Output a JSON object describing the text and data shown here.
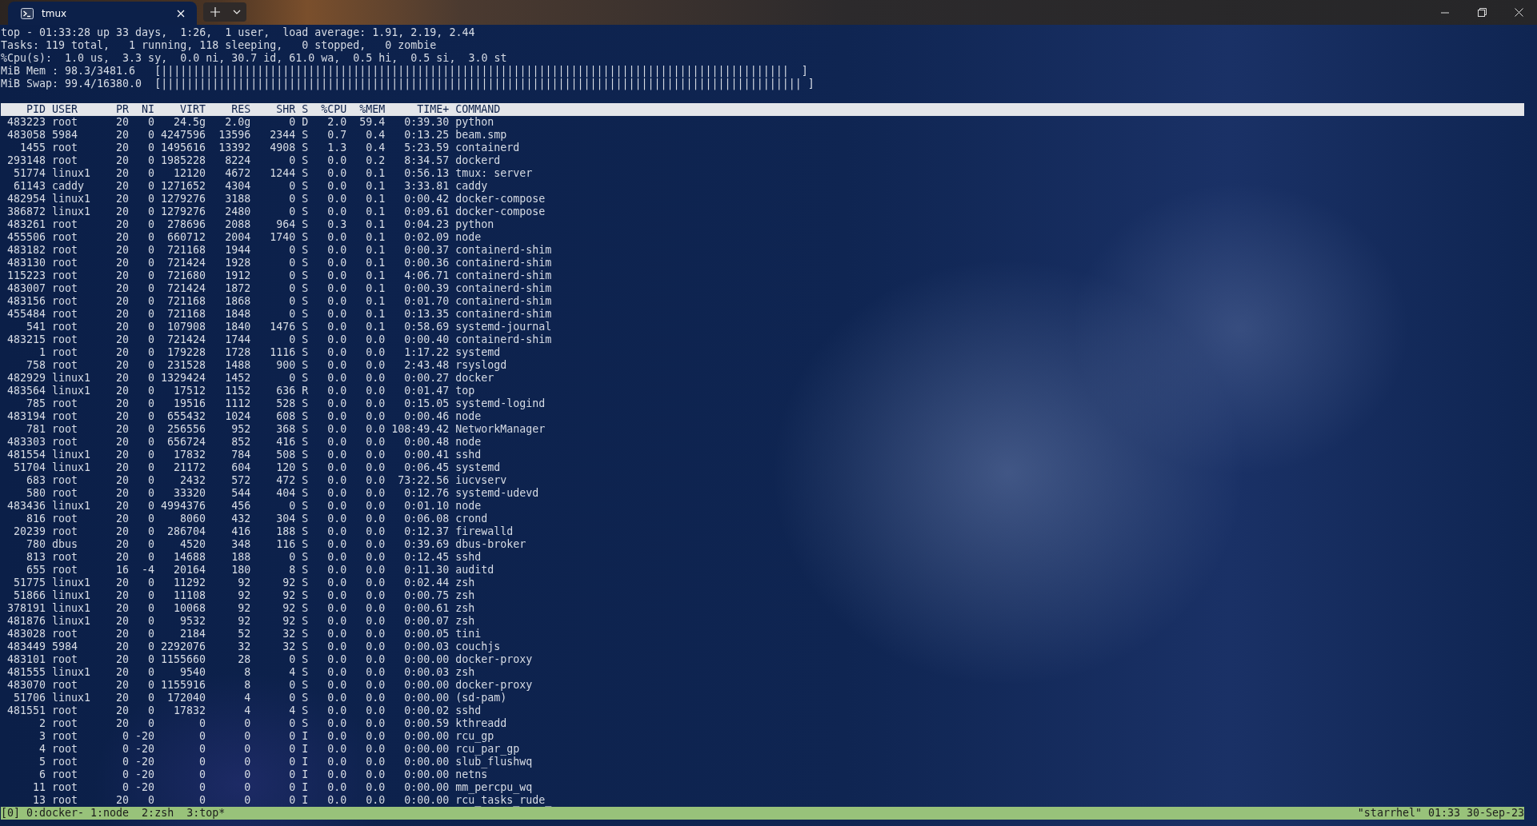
{
  "window": {
    "tabs": [
      {
        "title": "tmux",
        "selected": true
      }
    ]
  },
  "summary": [
    "top - 01:33:28 up 33 days,  1:26,  1 user,  load average: 1.91, 2.19, 2.44",
    "Tasks: 119 total,   1 running, 118 sleeping,   0 stopped,   0 zombie",
    "%Cpu(s):  1.0 us,  3.3 sy,  0.0 ni, 30.7 id, 61.0 wa,  0.5 hi,  0.5 si,  3.0 st"
  ],
  "memory": [
    {
      "label": "MiB Mem : 98.3/3481.6",
      "bar": "[||||||||||||||||||||||||||||||||||||||||||||||||||||||||||||||||||||||||||||||||||||||||||||||||||  ]"
    },
    {
      "label": "MiB Swap: 99.4/16380.0",
      "bar": "[|||||||||||||||||||||||||||||||||||||||||||||||||||||||||||||||||||||||||||||||||||||||||||||||||||| ]"
    }
  ],
  "table": {
    "columns": [
      "PID",
      "USER",
      "PR",
      "NI",
      "VIRT",
      "RES",
      "SHR",
      "S",
      "%CPU",
      "%MEM",
      "TIME+",
      "COMMAND"
    ],
    "rows": [
      [
        "483223",
        "root",
        "20",
        "0",
        "24.5g",
        "2.0g",
        "0",
        "D",
        "2.0",
        "59.4",
        "0:39.30",
        "python"
      ],
      [
        "483058",
        "5984",
        "20",
        "0",
        "4247596",
        "13596",
        "2344",
        "S",
        "0.7",
        "0.4",
        "0:13.25",
        "beam.smp"
      ],
      [
        "1455",
        "root",
        "20",
        "0",
        "1495616",
        "13392",
        "4908",
        "S",
        "1.3",
        "0.4",
        "5:23.59",
        "containerd"
      ],
      [
        "293148",
        "root",
        "20",
        "0",
        "1985228",
        "8224",
        "0",
        "S",
        "0.0",
        "0.2",
        "8:34.57",
        "dockerd"
      ],
      [
        "51774",
        "linux1",
        "20",
        "0",
        "12120",
        "4672",
        "1244",
        "S",
        "0.0",
        "0.1",
        "0:56.13",
        "tmux: server"
      ],
      [
        "61143",
        "caddy",
        "20",
        "0",
        "1271652",
        "4304",
        "0",
        "S",
        "0.0",
        "0.1",
        "3:33.81",
        "caddy"
      ],
      [
        "482954",
        "linux1",
        "20",
        "0",
        "1279276",
        "3188",
        "0",
        "S",
        "0.0",
        "0.1",
        "0:00.42",
        "docker-compose"
      ],
      [
        "386872",
        "linux1",
        "20",
        "0",
        "1279276",
        "2480",
        "0",
        "S",
        "0.0",
        "0.1",
        "0:09.61",
        "docker-compose"
      ],
      [
        "483261",
        "root",
        "20",
        "0",
        "278696",
        "2088",
        "964",
        "S",
        "0.3",
        "0.1",
        "0:04.23",
        "python"
      ],
      [
        "455506",
        "root",
        "20",
        "0",
        "660712",
        "2004",
        "1740",
        "S",
        "0.0",
        "0.1",
        "0:02.09",
        "node"
      ],
      [
        "483182",
        "root",
        "20",
        "0",
        "721168",
        "1944",
        "0",
        "S",
        "0.0",
        "0.1",
        "0:00.37",
        "containerd-shim"
      ],
      [
        "483130",
        "root",
        "20",
        "0",
        "721424",
        "1928",
        "0",
        "S",
        "0.0",
        "0.1",
        "0:00.36",
        "containerd-shim"
      ],
      [
        "115223",
        "root",
        "20",
        "0",
        "721680",
        "1912",
        "0",
        "S",
        "0.0",
        "0.1",
        "4:06.71",
        "containerd-shim"
      ],
      [
        "483007",
        "root",
        "20",
        "0",
        "721424",
        "1872",
        "0",
        "S",
        "0.0",
        "0.1",
        "0:00.39",
        "containerd-shim"
      ],
      [
        "483156",
        "root",
        "20",
        "0",
        "721168",
        "1868",
        "0",
        "S",
        "0.0",
        "0.1",
        "0:01.70",
        "containerd-shim"
      ],
      [
        "455484",
        "root",
        "20",
        "0",
        "721168",
        "1848",
        "0",
        "S",
        "0.0",
        "0.1",
        "0:13.35",
        "containerd-shim"
      ],
      [
        "541",
        "root",
        "20",
        "0",
        "107908",
        "1840",
        "1476",
        "S",
        "0.0",
        "0.1",
        "0:58.69",
        "systemd-journal"
      ],
      [
        "483215",
        "root",
        "20",
        "0",
        "721424",
        "1744",
        "0",
        "S",
        "0.0",
        "0.0",
        "0:00.40",
        "containerd-shim"
      ],
      [
        "1",
        "root",
        "20",
        "0",
        "179228",
        "1728",
        "1116",
        "S",
        "0.0",
        "0.0",
        "1:17.22",
        "systemd"
      ],
      [
        "758",
        "root",
        "20",
        "0",
        "231528",
        "1488",
        "900",
        "S",
        "0.0",
        "0.0",
        "2:43.48",
        "rsyslogd"
      ],
      [
        "482929",
        "linux1",
        "20",
        "0",
        "1329424",
        "1452",
        "0",
        "S",
        "0.0",
        "0.0",
        "0:00.27",
        "docker"
      ],
      [
        "483564",
        "linux1",
        "20",
        "0",
        "17512",
        "1152",
        "636",
        "R",
        "0.0",
        "0.0",
        "0:01.47",
        "top"
      ],
      [
        "785",
        "root",
        "20",
        "0",
        "19516",
        "1112",
        "528",
        "S",
        "0.0",
        "0.0",
        "0:15.05",
        "systemd-logind"
      ],
      [
        "483194",
        "root",
        "20",
        "0",
        "655432",
        "1024",
        "608",
        "S",
        "0.0",
        "0.0",
        "0:00.46",
        "node"
      ],
      [
        "781",
        "root",
        "20",
        "0",
        "256556",
        "952",
        "368",
        "S",
        "0.0",
        "0.0",
        "108:49.42",
        "NetworkManager"
      ],
      [
        "483303",
        "root",
        "20",
        "0",
        "656724",
        "852",
        "416",
        "S",
        "0.0",
        "0.0",
        "0:00.48",
        "node"
      ],
      [
        "481554",
        "linux1",
        "20",
        "0",
        "17832",
        "784",
        "508",
        "S",
        "0.0",
        "0.0",
        "0:00.41",
        "sshd"
      ],
      [
        "51704",
        "linux1",
        "20",
        "0",
        "21172",
        "604",
        "120",
        "S",
        "0.0",
        "0.0",
        "0:06.45",
        "systemd"
      ],
      [
        "683",
        "root",
        "20",
        "0",
        "2432",
        "572",
        "472",
        "S",
        "0.0",
        "0.0",
        "73:22.56",
        "iucvserv"
      ],
      [
        "580",
        "root",
        "20",
        "0",
        "33320",
        "544",
        "404",
        "S",
        "0.0",
        "0.0",
        "0:12.76",
        "systemd-udevd"
      ],
      [
        "483436",
        "linux1",
        "20",
        "0",
        "4994376",
        "456",
        "0",
        "S",
        "0.0",
        "0.0",
        "0:01.10",
        "node"
      ],
      [
        "816",
        "root",
        "20",
        "0",
        "8060",
        "432",
        "304",
        "S",
        "0.0",
        "0.0",
        "0:06.08",
        "crond"
      ],
      [
        "20239",
        "root",
        "20",
        "0",
        "286704",
        "416",
        "188",
        "S",
        "0.0",
        "0.0",
        "0:12.37",
        "firewalld"
      ],
      [
        "780",
        "dbus",
        "20",
        "0",
        "4520",
        "348",
        "116",
        "S",
        "0.0",
        "0.0",
        "0:39.69",
        "dbus-broker"
      ],
      [
        "813",
        "root",
        "20",
        "0",
        "14688",
        "188",
        "0",
        "S",
        "0.0",
        "0.0",
        "0:12.45",
        "sshd"
      ],
      [
        "655",
        "root",
        "16",
        "-4",
        "20164",
        "180",
        "8",
        "S",
        "0.0",
        "0.0",
        "0:11.30",
        "auditd"
      ],
      [
        "51775",
        "linux1",
        "20",
        "0",
        "11292",
        "92",
        "92",
        "S",
        "0.0",
        "0.0",
        "0:02.44",
        "zsh"
      ],
      [
        "51866",
        "linux1",
        "20",
        "0",
        "11108",
        "92",
        "92",
        "S",
        "0.0",
        "0.0",
        "0:00.75",
        "zsh"
      ],
      [
        "378191",
        "linux1",
        "20",
        "0",
        "10068",
        "92",
        "92",
        "S",
        "0.0",
        "0.0",
        "0:00.61",
        "zsh"
      ],
      [
        "481876",
        "linux1",
        "20",
        "0",
        "9532",
        "92",
        "92",
        "S",
        "0.0",
        "0.0",
        "0:00.07",
        "zsh"
      ],
      [
        "483028",
        "root",
        "20",
        "0",
        "2184",
        "52",
        "32",
        "S",
        "0.0",
        "0.0",
        "0:00.05",
        "tini"
      ],
      [
        "483449",
        "5984",
        "20",
        "0",
        "2292076",
        "32",
        "32",
        "S",
        "0.0",
        "0.0",
        "0:00.03",
        "couchjs"
      ],
      [
        "483101",
        "root",
        "20",
        "0",
        "1155660",
        "28",
        "0",
        "S",
        "0.0",
        "0.0",
        "0:00.00",
        "docker-proxy"
      ],
      [
        "481555",
        "linux1",
        "20",
        "0",
        "9540",
        "8",
        "4",
        "S",
        "0.0",
        "0.0",
        "0:00.03",
        "zsh"
      ],
      [
        "483070",
        "root",
        "20",
        "0",
        "1155916",
        "8",
        "0",
        "S",
        "0.0",
        "0.0",
        "0:00.00",
        "docker-proxy"
      ],
      [
        "51706",
        "linux1",
        "20",
        "0",
        "172040",
        "4",
        "0",
        "S",
        "0.0",
        "0.0",
        "0:00.00",
        "(sd-pam)"
      ],
      [
        "481551",
        "root",
        "20",
        "0",
        "17832",
        "4",
        "4",
        "S",
        "0.0",
        "0.0",
        "0:00.02",
        "sshd"
      ],
      [
        "2",
        "root",
        "20",
        "0",
        "0",
        "0",
        "0",
        "S",
        "0.0",
        "0.0",
        "0:00.59",
        "kthreadd"
      ],
      [
        "3",
        "root",
        "0",
        "-20",
        "0",
        "0",
        "0",
        "I",
        "0.0",
        "0.0",
        "0:00.00",
        "rcu_gp"
      ],
      [
        "4",
        "root",
        "0",
        "-20",
        "0",
        "0",
        "0",
        "I",
        "0.0",
        "0.0",
        "0:00.00",
        "rcu_par_gp"
      ],
      [
        "5",
        "root",
        "0",
        "-20",
        "0",
        "0",
        "0",
        "I",
        "0.0",
        "0.0",
        "0:00.00",
        "slub_flushwq"
      ],
      [
        "6",
        "root",
        "0",
        "-20",
        "0",
        "0",
        "0",
        "I",
        "0.0",
        "0.0",
        "0:00.00",
        "netns"
      ],
      [
        "11",
        "root",
        "0",
        "-20",
        "0",
        "0",
        "0",
        "I",
        "0.0",
        "0.0",
        "0:00.00",
        "mm_percpu_wq"
      ],
      [
        "13",
        "root",
        "20",
        "0",
        "0",
        "0",
        "0",
        "I",
        "0.0",
        "0.0",
        "0:00.00",
        "rcu_tasks_rude_"
      ]
    ]
  },
  "status_bar": {
    "left": "[0] 0:docker- 1:node  2:zsh  3:top*",
    "right": "\"starrhel\" 01:33 30-Sep-23"
  }
}
